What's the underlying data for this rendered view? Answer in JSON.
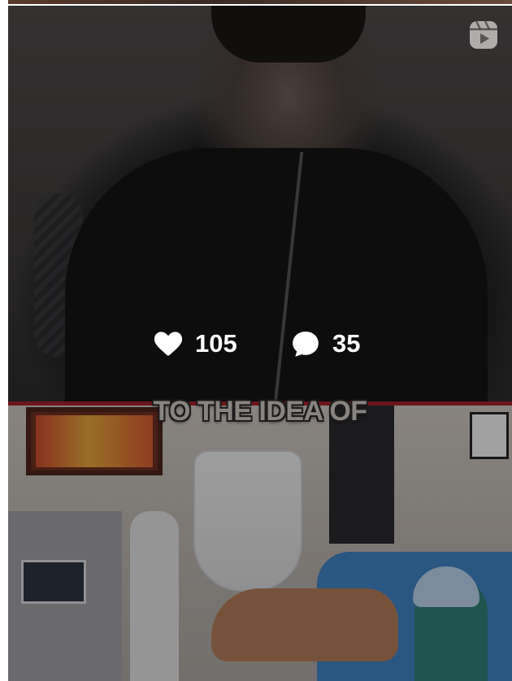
{
  "post": {
    "type_icon": "reels-icon",
    "overlay_caption": "TO THE IDEA OF",
    "stats": {
      "likes": {
        "icon": "heart-icon",
        "value": "105"
      },
      "comments": {
        "icon": "comment-icon",
        "value": "35"
      }
    }
  },
  "colors": {
    "stat_text": "#ffffff",
    "divider": "#a02028",
    "overlay": "rgba(0,0,0,0.32)"
  }
}
